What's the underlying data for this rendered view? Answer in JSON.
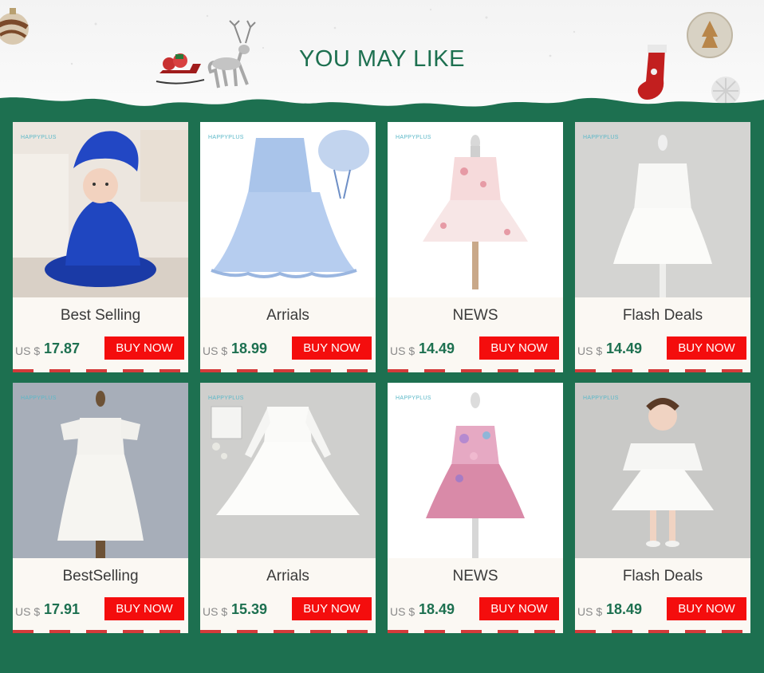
{
  "header": {
    "title": "YOU MAY LIKE"
  },
  "colors": {
    "accent": "#1d7050",
    "buy_button": "#f40d0d",
    "card_bg": "#fbf8f3"
  },
  "products": [
    {
      "label": "Best Selling",
      "currency": "US $",
      "price": "17.87",
      "button": "BUY NOW",
      "brand": "HAPPYPLUS",
      "image": "royal-blue-satin-dress-with-bonnet"
    },
    {
      "label": "Arrials",
      "currency": "US $",
      "price": "18.99",
      "button": "BUY NOW",
      "brand": "HAPPYPLUS",
      "image": "light-blue-lace-dress-with-bonnet"
    },
    {
      "label": "NEWS",
      "currency": "US $",
      "price": "14.49",
      "button": "BUY NOW",
      "brand": "HAPPYPLUS",
      "image": "pink-floral-tulle-dress"
    },
    {
      "label": "Flash Deals",
      "currency": "US $",
      "price": "14.49",
      "button": "BUY NOW",
      "brand": "HAPPYPLUS",
      "image": "white-tulle-dress"
    },
    {
      "label": "BestSelling",
      "currency": "US $",
      "price": "17.91",
      "button": "BUY NOW",
      "brand": "HAPPYPLUS",
      "image": "white-lace-christening-gown"
    },
    {
      "label": "Arrials",
      "currency": "US $",
      "price": "15.39",
      "button": "BUY NOW",
      "brand": "HAPPYPLUS",
      "image": "white-long-sleeve-tulle-dress"
    },
    {
      "label": "NEWS",
      "currency": "US $",
      "price": "18.49",
      "button": "BUY NOW",
      "brand": "HAPPYPLUS",
      "image": "pink-flower-applique-dress"
    },
    {
      "label": "Flash Deals",
      "currency": "US $",
      "price": "18.49",
      "button": "BUY NOW",
      "brand": "HAPPYPLUS",
      "image": "white-dress-with-cape"
    }
  ]
}
